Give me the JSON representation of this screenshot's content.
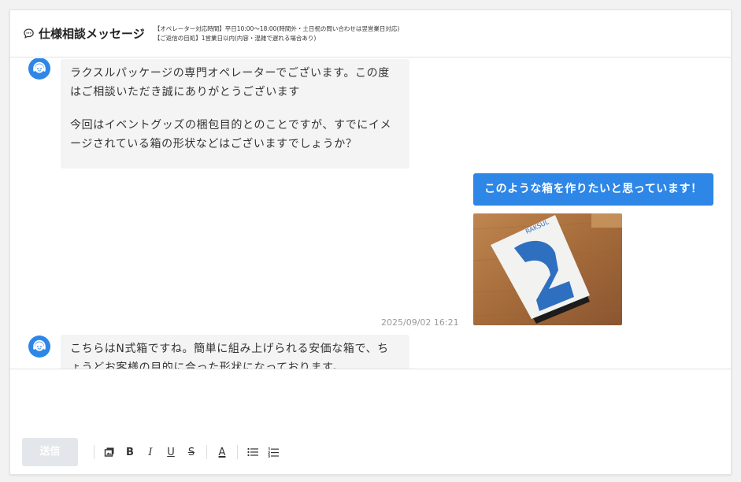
{
  "header": {
    "title": "仕様相談メッセージ",
    "hours": "【オペレーター対応時間】平日10:00〜18:00(時間外・土日祝の問い合わせは翌営業日対応)",
    "reply": "【ご返信の目処】1営業日以内(内容・混雑で遅れる場合あり)"
  },
  "messages": [
    {
      "from": "operator",
      "paragraphs": [
        "ラクスルパッケージの専門オペレーターでございます。この度\nはご相談いただき誠にありがとうございます",
        "今回はイベントグッズの梱包目的とのことですが、すでにイメ\nージされている箱の形状などはございますでしょうか？"
      ]
    },
    {
      "from": "user",
      "text": "このような箱を作りたいと思っています！",
      "image_text": "RAKSUL",
      "timestamp": "2025/09/02 16:21"
    },
    {
      "from": "operator",
      "paragraphs": [
        "こちらはN式箱ですね。簡単に組み上げられる安価な箱で、ち\nょうどお客様の目的に合った形状になっております。"
      ]
    }
  ],
  "composer": {
    "send_label": "送信",
    "tools": [
      "image",
      "bold",
      "italic",
      "underline",
      "strikethrough",
      "text-color",
      "bullet-list",
      "numbered-list"
    ],
    "tool_glyphs": {
      "bold": "B",
      "italic": "I",
      "underline": "U",
      "strike": "S",
      "color": "A"
    }
  },
  "colors": {
    "accent": "#2e86e6",
    "bubble": "#f4f4f4",
    "send_disabled": "#e3e6ea"
  }
}
